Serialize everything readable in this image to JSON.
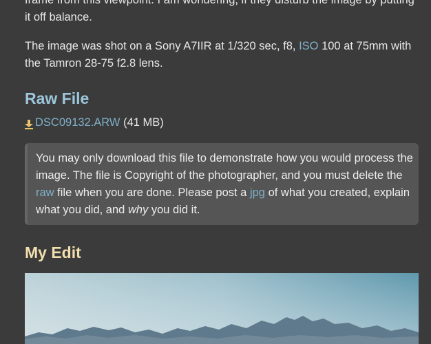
{
  "post": {
    "para1": "frame from this viewpoint. I am wondering, if they disturb the image by putting it off balance.",
    "para2_pre": "The image was shot on a Sony A7IIR at 1/320 sec, f8, ",
    "para2_link": "ISO",
    "para2_post": " 100 at 75mm with the Tamron 28-75 f2.8 lens."
  },
  "raw_file": {
    "heading": "Raw File",
    "download_icon": "download-icon",
    "filename": "DSC09132.ARW",
    "size": "(41 MB)"
  },
  "notice": {
    "text_1": "You may only download this file to demonstrate how you would process the image. The file is Copyright of the photographer, and you must delete the ",
    "link_raw": "raw",
    "text_2": " file when you are done. Please post a ",
    "link_jpg": "jpg",
    "text_3": " of what you created, explain what you did, and ",
    "emphasis": "why",
    "text_4": " you did it."
  },
  "my_edit": {
    "heading": "My Edit"
  },
  "colors": {
    "background": "#3b3b3b",
    "link": "#7fb0c8",
    "heading_raw": "#9cc7dc",
    "heading_edit": "#f2dfae",
    "quote_bg": "#555555"
  }
}
